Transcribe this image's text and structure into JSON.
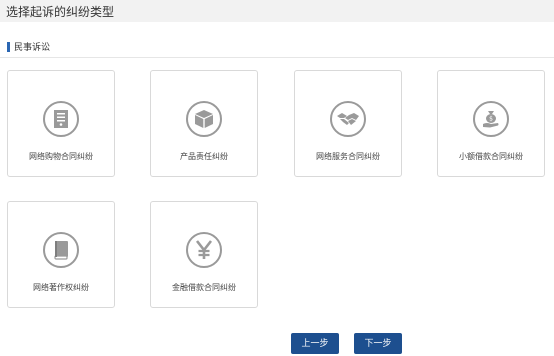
{
  "header": {
    "title": "选择起诉的纠纷类型"
  },
  "section": {
    "title": "民事诉讼"
  },
  "cards": [
    {
      "label": "网络购物合同纠纷",
      "icon": "document-icon"
    },
    {
      "label": "产品责任纠纷",
      "icon": "box-icon"
    },
    {
      "label": "网络服务合同纠纷",
      "icon": "handshake-icon"
    },
    {
      "label": "小额借款合同纠纷",
      "icon": "money-bag-hand-icon"
    },
    {
      "label": "网络著作权纠纷",
      "icon": "book-icon"
    },
    {
      "label": "金融借款合同纠纷",
      "icon": "yen-icon"
    }
  ],
  "buttons": {
    "prev": "上一步",
    "next": "下一步"
  },
  "colors": {
    "accent": "#1d4f8f",
    "section_bar": "#2b67b3",
    "icon_gray": "#9a9a9a"
  }
}
